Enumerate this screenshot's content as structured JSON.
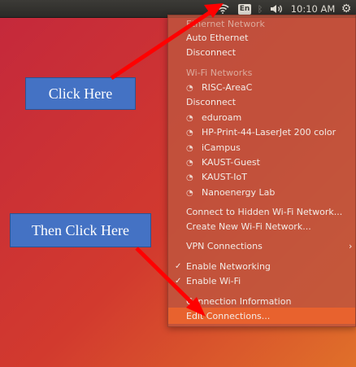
{
  "panel": {
    "keyboard_layout": "En",
    "clock": "10:10 AM",
    "icons": {
      "wifi": "wifi-icon",
      "keyboard": "keyboard-layout-icon",
      "bluetooth": "bluetooth-icon",
      "volume": "volume-icon",
      "gear": "gear-icon"
    },
    "glyphs": {
      "bluetooth": "ᛒ",
      "volume": "◀))",
      "gear": "⚙"
    }
  },
  "menu": {
    "ethernet_header": "Ethernet Network",
    "auto_ethernet": "Auto Ethernet",
    "disconnect_ethernet": "Disconnect",
    "wifi_header": "Wi-Fi Networks",
    "wifi_connected": "RISC-AreaC",
    "disconnect_wifi": "Disconnect",
    "wifi_networks": [
      "eduroam",
      "HP-Print-44-LaserJet 200 color",
      "iCampus",
      "KAUST-Guest",
      "KAUST-IoT",
      "Nanoenergy Lab"
    ],
    "connect_hidden": "Connect to Hidden Wi-Fi Network...",
    "create_new": "Create New Wi-Fi Network...",
    "vpn": "VPN Connections",
    "enable_networking": "Enable Networking",
    "enable_wifi": "Enable Wi-Fi",
    "connection_info": "Connection Information",
    "edit_connections": "Edit Connections...",
    "check_glyph": "✓",
    "arrow_glyph": "›",
    "wifi_glyph": "◔"
  },
  "callouts": {
    "first": "Click Here",
    "second": "Then Click Here"
  },
  "colors": {
    "callout": "#4472c4",
    "arrow": "#ff0000",
    "highlight": "#e8622e"
  }
}
